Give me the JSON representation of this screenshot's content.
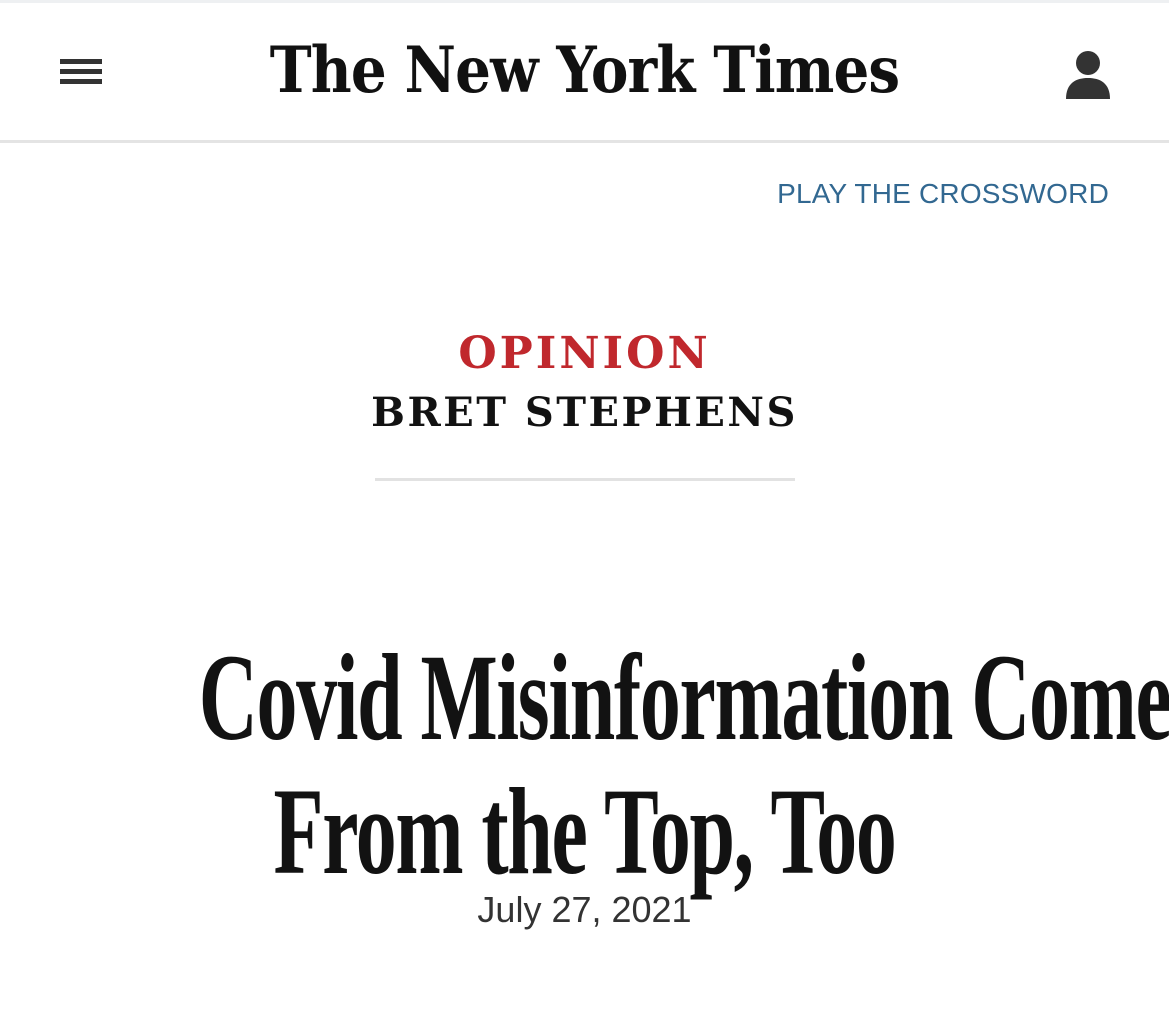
{
  "header": {
    "masthead": "The New York Times",
    "menu_icon": "hamburger-menu-icon",
    "account_icon": "user-account-icon"
  },
  "crossword_link": "PLAY THE CROSSWORD",
  "article": {
    "kicker": "OPINION",
    "byline": "BRET STEPHENS",
    "headline_line1": "Covid Misinformation Comes",
    "headline_line2": "From the Top, Too",
    "date": "July 27, 2021"
  },
  "colors": {
    "opinion_red": "#c0282d",
    "link_blue": "#326891",
    "text_dark": "#121212"
  }
}
